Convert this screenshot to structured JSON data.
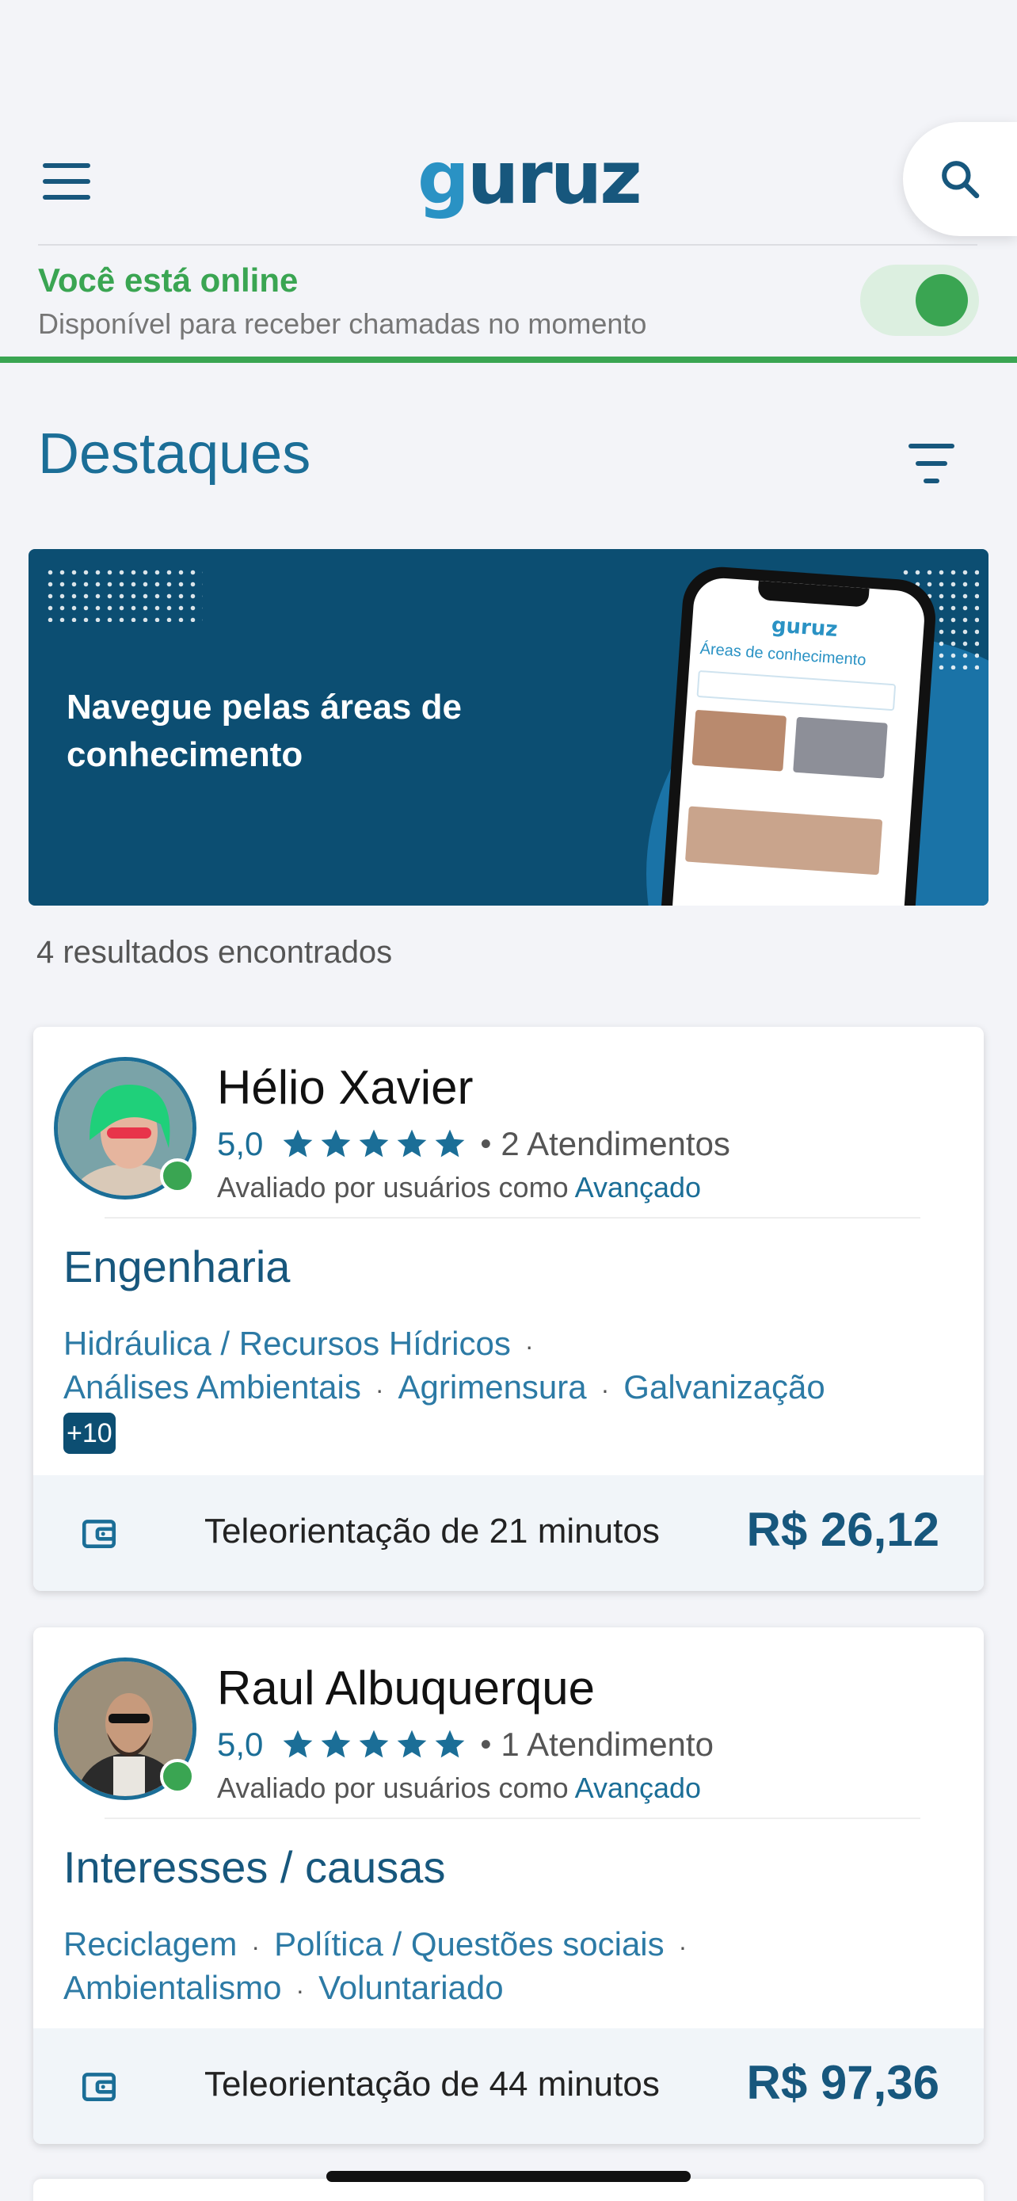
{
  "header": {
    "logo_text": "guruz",
    "menu_icon": "hamburger-menu-icon",
    "search_icon": "search-icon"
  },
  "status": {
    "title": "Você está online",
    "subtitle": "Disponível para receber chamadas no momento",
    "toggle_on": true,
    "color": "#3aa552"
  },
  "section": {
    "title": "Destaques",
    "filter_icon": "filter-icon"
  },
  "banner": {
    "text": "Navegue pelas áreas de conhecimento",
    "phone_heading": "Áreas de conhecimento",
    "phone_logo": "guruz"
  },
  "results": {
    "count_text": "4 resultados encontrados"
  },
  "experts": [
    {
      "name": "Hélio Xavier",
      "rating": "5,0",
      "stars": 5,
      "sessions": "2 Atendimentos",
      "evaluated_prefix": "Avaliado por usuários como",
      "level": "Avançado",
      "category": "Engenharia",
      "tags": [
        "Hidráulica / Recursos Hídricos",
        "Análises Ambientais",
        "Agrimensura",
        "Galvanização"
      ],
      "more": "+10",
      "footer_label": "Teleorientação de 21 minutos",
      "price": "R$ 26,12"
    },
    {
      "name": "Raul Albuquerque",
      "rating": "5,0",
      "stars": 5,
      "sessions": "1 Atendimento",
      "evaluated_prefix": "Avaliado por usuários como",
      "level": "Avançado",
      "category": "Interesses / causas",
      "tags": [
        "Reciclagem",
        "Política / Questões sociais",
        "Ambientalismo",
        "Voluntariado"
      ],
      "footer_label": "Teleorientação de 44 minutos",
      "price": "R$ 97,36"
    }
  ],
  "colors": {
    "primary": "#17577d",
    "accent": "#1b6e97",
    "online_green": "#3aa552",
    "background": "#f3f4f8"
  }
}
